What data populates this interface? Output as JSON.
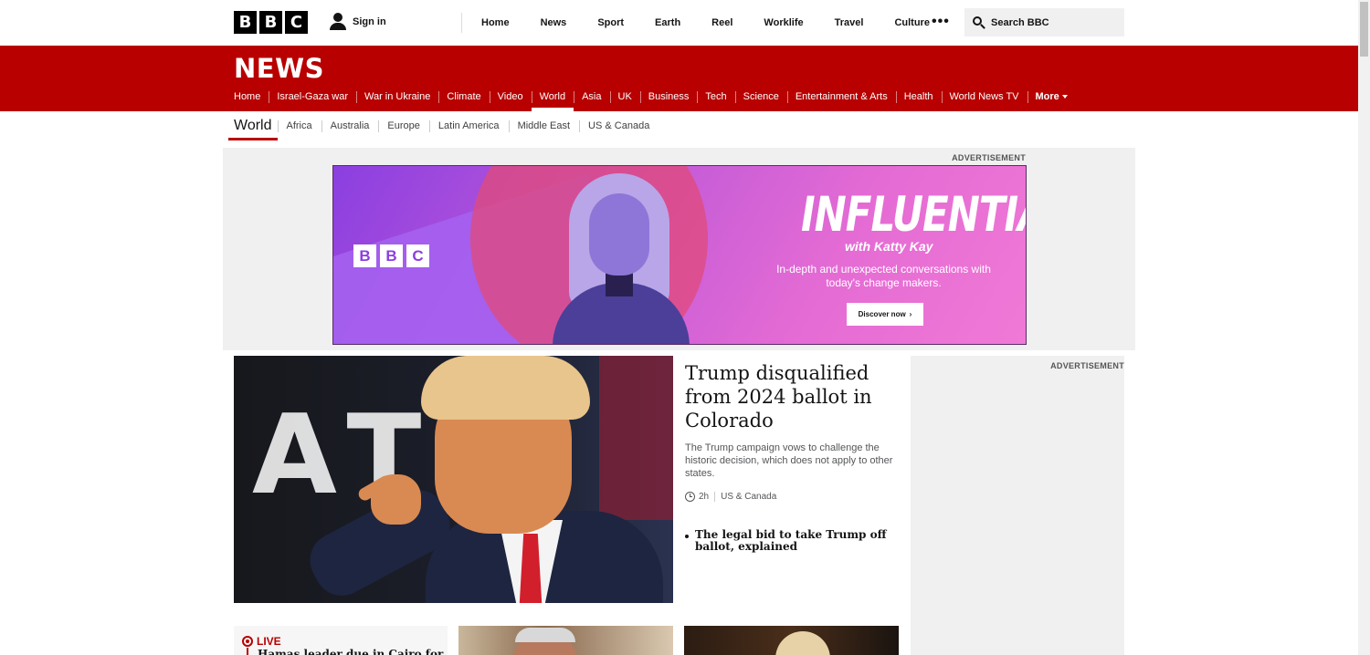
{
  "header": {
    "logo_letters": [
      "B",
      "B",
      "C"
    ],
    "sign_in": "Sign in",
    "nav": [
      "Home",
      "News",
      "Sport",
      "Earth",
      "Reel",
      "Worklife",
      "Travel",
      "Culture"
    ],
    "more": "•••",
    "search_text": "Search BBC"
  },
  "news": {
    "title": "NEWS",
    "nav": [
      "Home",
      "Israel-Gaza war",
      "War in Ukraine",
      "Climate",
      "Video",
      "World",
      "Asia",
      "UK",
      "Business",
      "Tech",
      "Science",
      "Entertainment & Arts",
      "Health",
      "World News TV"
    ],
    "active": "World",
    "more": "More"
  },
  "subnav": {
    "current": "World",
    "items": [
      "Africa",
      "Australia",
      "Europe",
      "Latin America",
      "Middle East",
      "US & Canada"
    ]
  },
  "ad_top": {
    "label": "ADVERTISEMENT",
    "brand_letters": [
      "B",
      "B",
      "C"
    ],
    "title": "INFLUENTIAL",
    "with": "with Katty Kay",
    "subtitle": "In-depth and unexpected conversations with today's change makers.",
    "button": "Discover now",
    "button_icon": "›"
  },
  "hero": {
    "headline": "Trump disqualified from 2024 ballot in Colorado",
    "summary": "The Trump campaign vows to challenge the historic decision, which does not apply to other states.",
    "time": "2h",
    "category": "US & Canada",
    "related": "The legal bid to take Trump off ballot, explained"
  },
  "ad_side": {
    "label": "ADVERTISEMENT"
  },
  "bottom": {
    "live_label": "LIVE",
    "live_text": "Hamas leader due in Cairo for"
  },
  "colors": {
    "brand_red": "#b80000",
    "text": "#141414"
  }
}
